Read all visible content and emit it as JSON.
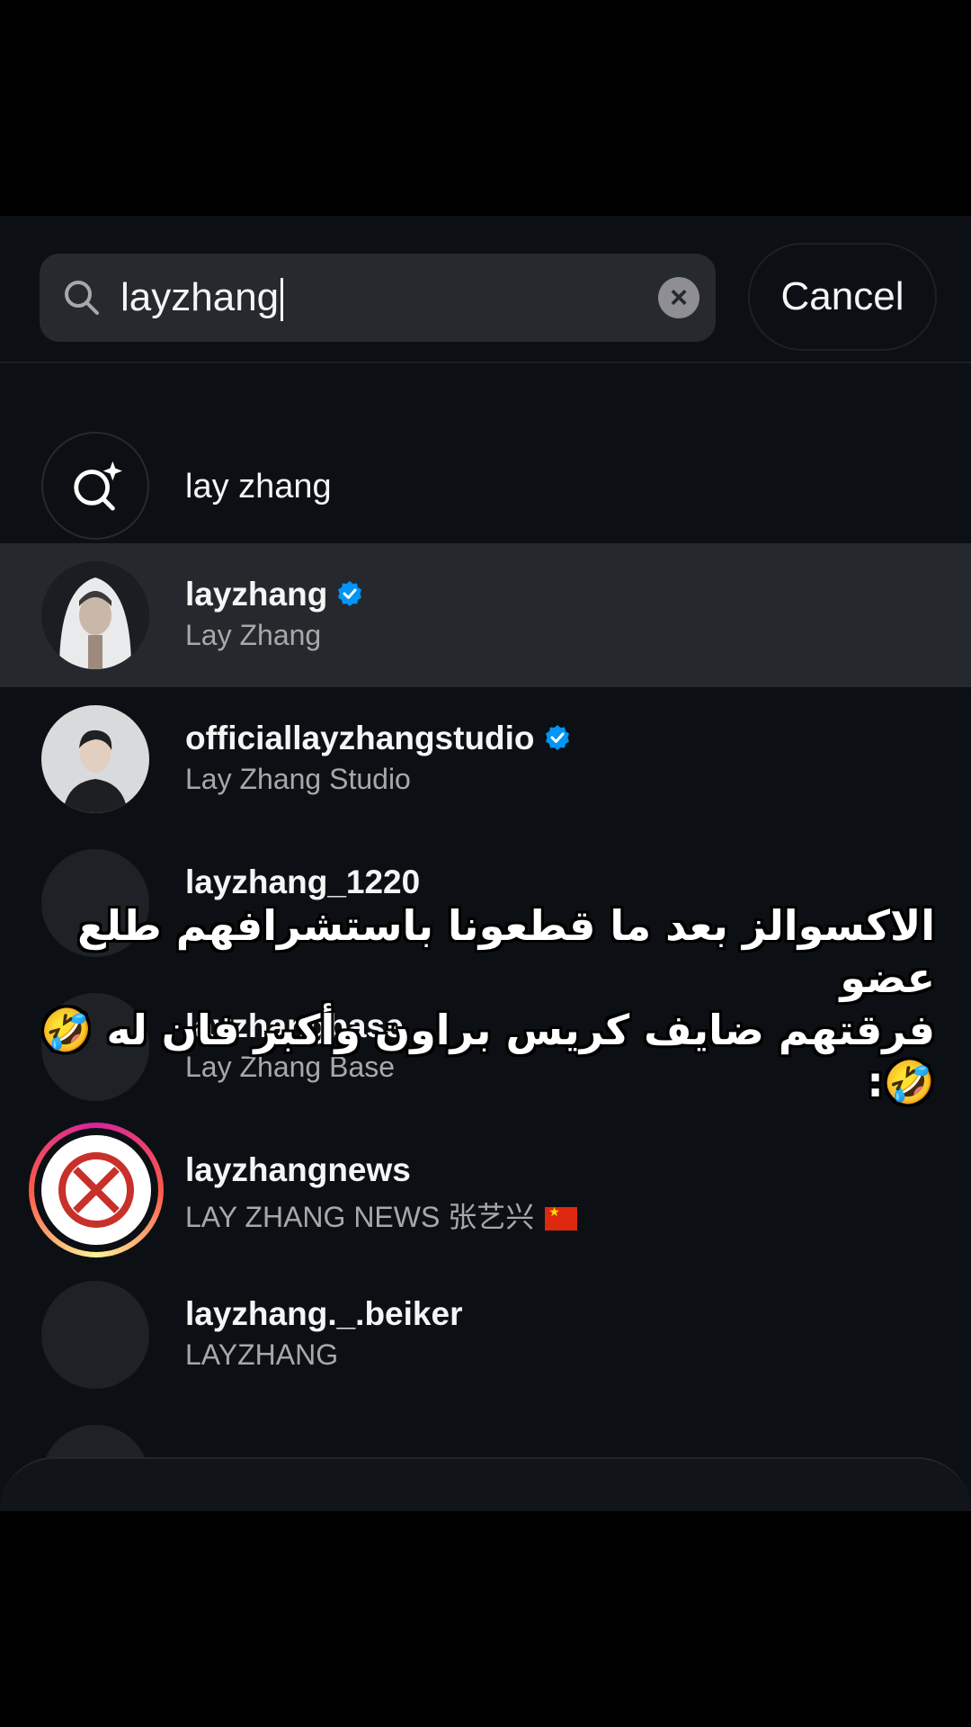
{
  "search": {
    "value": "layzhang",
    "cancel_label": "Cancel"
  },
  "suggestion": {
    "query": "lay zhang"
  },
  "results": [
    {
      "username": "layzhang",
      "fullname": "Lay Zhang",
      "verified": true,
      "highlighted": true
    },
    {
      "username": "officiallayzhangstudio",
      "fullname": "Lay Zhang Studio",
      "verified": true
    },
    {
      "username": "layzhang_1220",
      "fullname": "",
      "verified": false
    },
    {
      "username": "layzhangbase",
      "fullname": "Lay Zhang Base",
      "verified": false
    },
    {
      "username": "layzhangnews",
      "fullname": "LAY ZHANG NEWS 张艺兴",
      "verified": false,
      "flag": "china-flag-icon"
    },
    {
      "username": "layzhang._.beiker",
      "fullname": "LAYZHANG",
      "verified": false
    }
  ],
  "caption": {
    "line1": "الاكسوالز بعد ما قطعونا باستشرافهم طلع عضو",
    "line2": "فرقتهم ضايف كريس براون وأكبر فان له 🤣🤣:"
  },
  "colors": {
    "background": "#0c1014",
    "verified": "#0095f6",
    "secondary_text": "#a8a8a8"
  }
}
